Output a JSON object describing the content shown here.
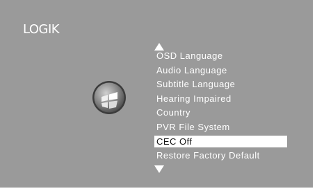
{
  "brand": {
    "logo_text": "LOGIK"
  },
  "icons": {
    "up": "arrow-up-icon",
    "down": "arrow-down-icon",
    "emblem": "settings-emblem-icon"
  },
  "menu": {
    "items": [
      {
        "label": "OSD Language",
        "selected": false
      },
      {
        "label": "Audio Language",
        "selected": false
      },
      {
        "label": "Subtitle Language",
        "selected": false
      },
      {
        "label": "Hearing Impaired",
        "selected": false
      },
      {
        "label": "Country",
        "selected": false
      },
      {
        "label": "PVR File System",
        "selected": false
      },
      {
        "label": "CEC Off",
        "selected": true
      },
      {
        "label": "Restore Factory Default",
        "selected": false
      }
    ]
  },
  "colors": {
    "background": "#9a9a9a",
    "text": "#ffffff",
    "highlight_bg": "#ffffff",
    "highlight_text": "#111111"
  }
}
